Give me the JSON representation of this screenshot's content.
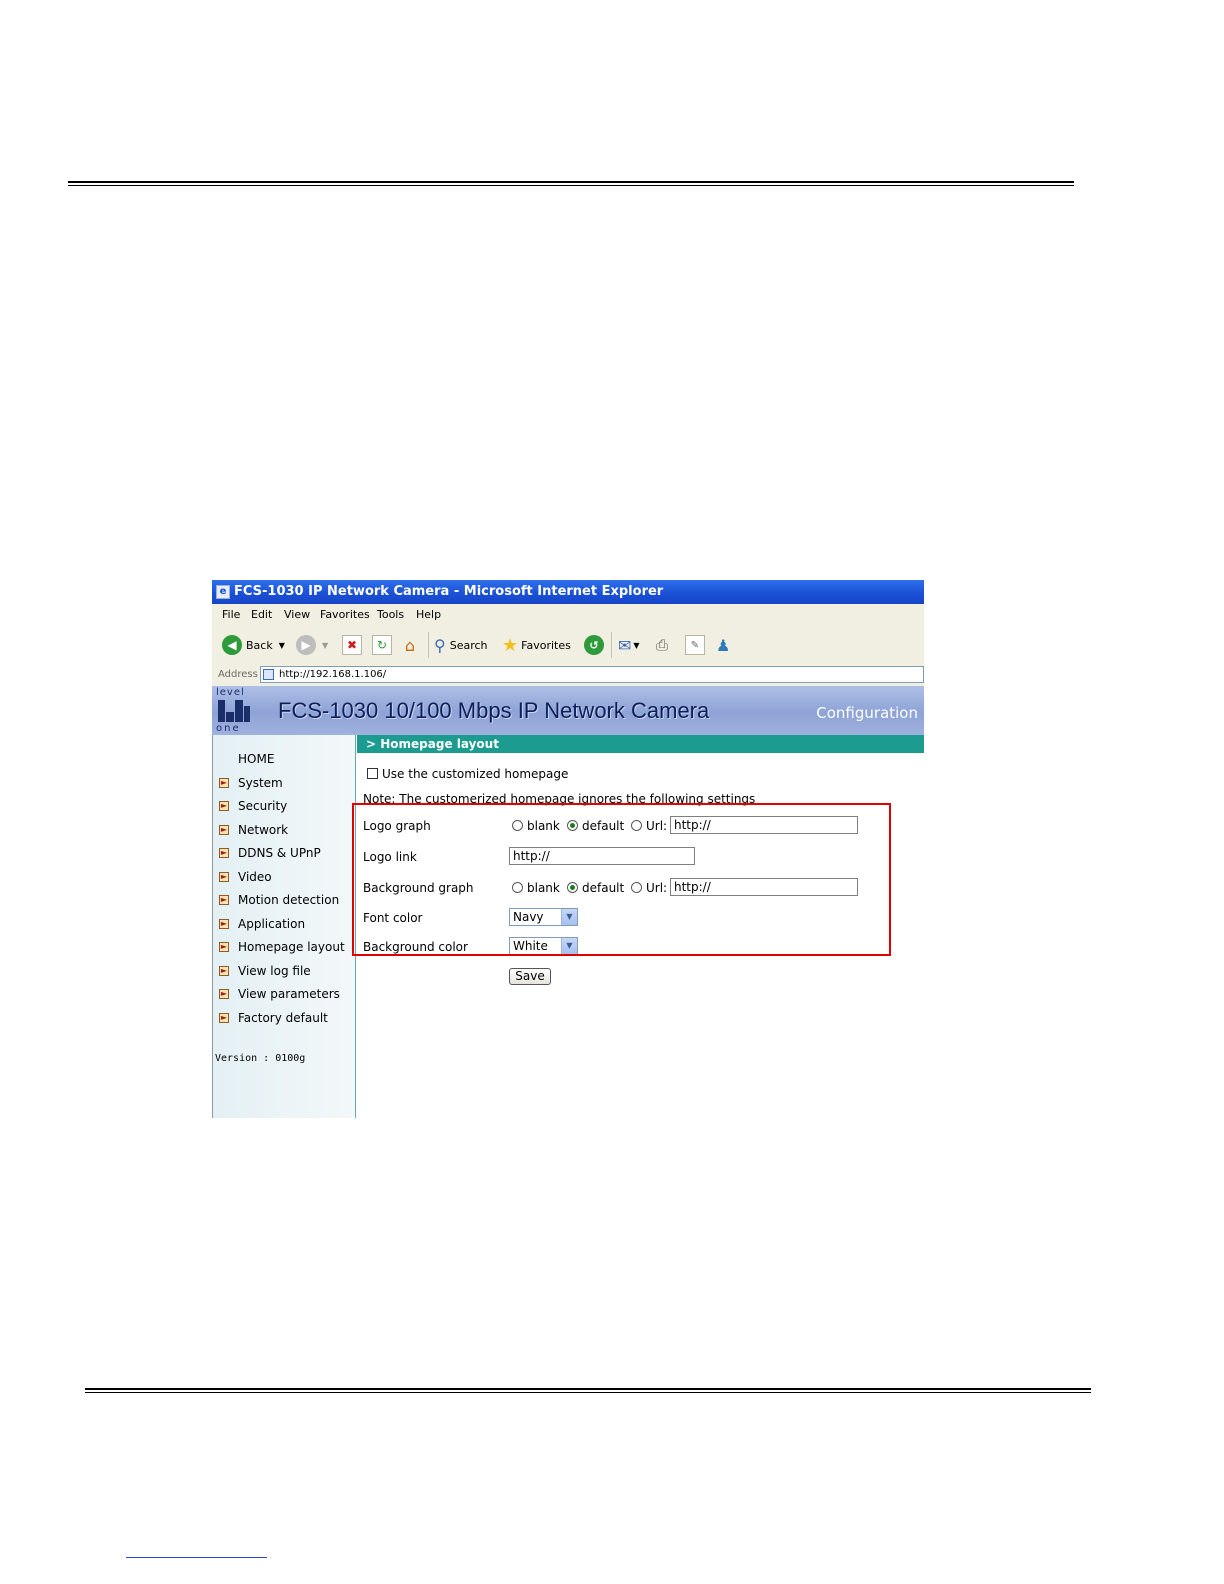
{
  "window": {
    "title": "FCS-1030 IP Network Camera - Microsoft Internet Explorer"
  },
  "menu": [
    "File",
    "Edit",
    "View",
    "Favorites",
    "Tools",
    "Help"
  ],
  "toolbar": {
    "back": "Back",
    "search": "Search",
    "favorites": "Favorites"
  },
  "address": {
    "label": "Address",
    "url": "http://192.168.1.106/"
  },
  "banner": {
    "logo_top": "level",
    "logo_bottom": "one",
    "headline": "FCS-1030  10/100 Mbps IP Network Camera",
    "config": "Configuration"
  },
  "sidebar": {
    "home": "HOME",
    "items": [
      "System",
      "Security",
      "Network",
      "DDNS & UPnP",
      "Video",
      "Motion detection",
      "Application",
      "Homepage layout",
      "View log file",
      "View parameters",
      "Factory default"
    ],
    "version": "Version : 0100g"
  },
  "section": {
    "title": "> Homepage layout"
  },
  "form": {
    "customize_label": "Use the customized homepage",
    "customize_checked": false,
    "note": "Note: The customerized homepage ignores the following settings",
    "logo_graph": {
      "label": "Logo graph",
      "blank": "blank",
      "default": "default",
      "url": "Url:",
      "selected": "default",
      "url_value": "http://"
    },
    "logo_link": {
      "label": "Logo link",
      "value": "http://"
    },
    "background_graph": {
      "label": "Background graph",
      "blank": "blank",
      "default": "default",
      "url": "Url:",
      "selected": "default",
      "url_value": "http://"
    },
    "font_color": {
      "label": "Font color",
      "value": "Navy"
    },
    "background_color": {
      "label": "Background color",
      "value": "White"
    },
    "save": "Save"
  },
  "colors": {
    "titlebar": "#1a4fd4",
    "section_head": "#1c9b91",
    "highlight": "#e00000"
  }
}
